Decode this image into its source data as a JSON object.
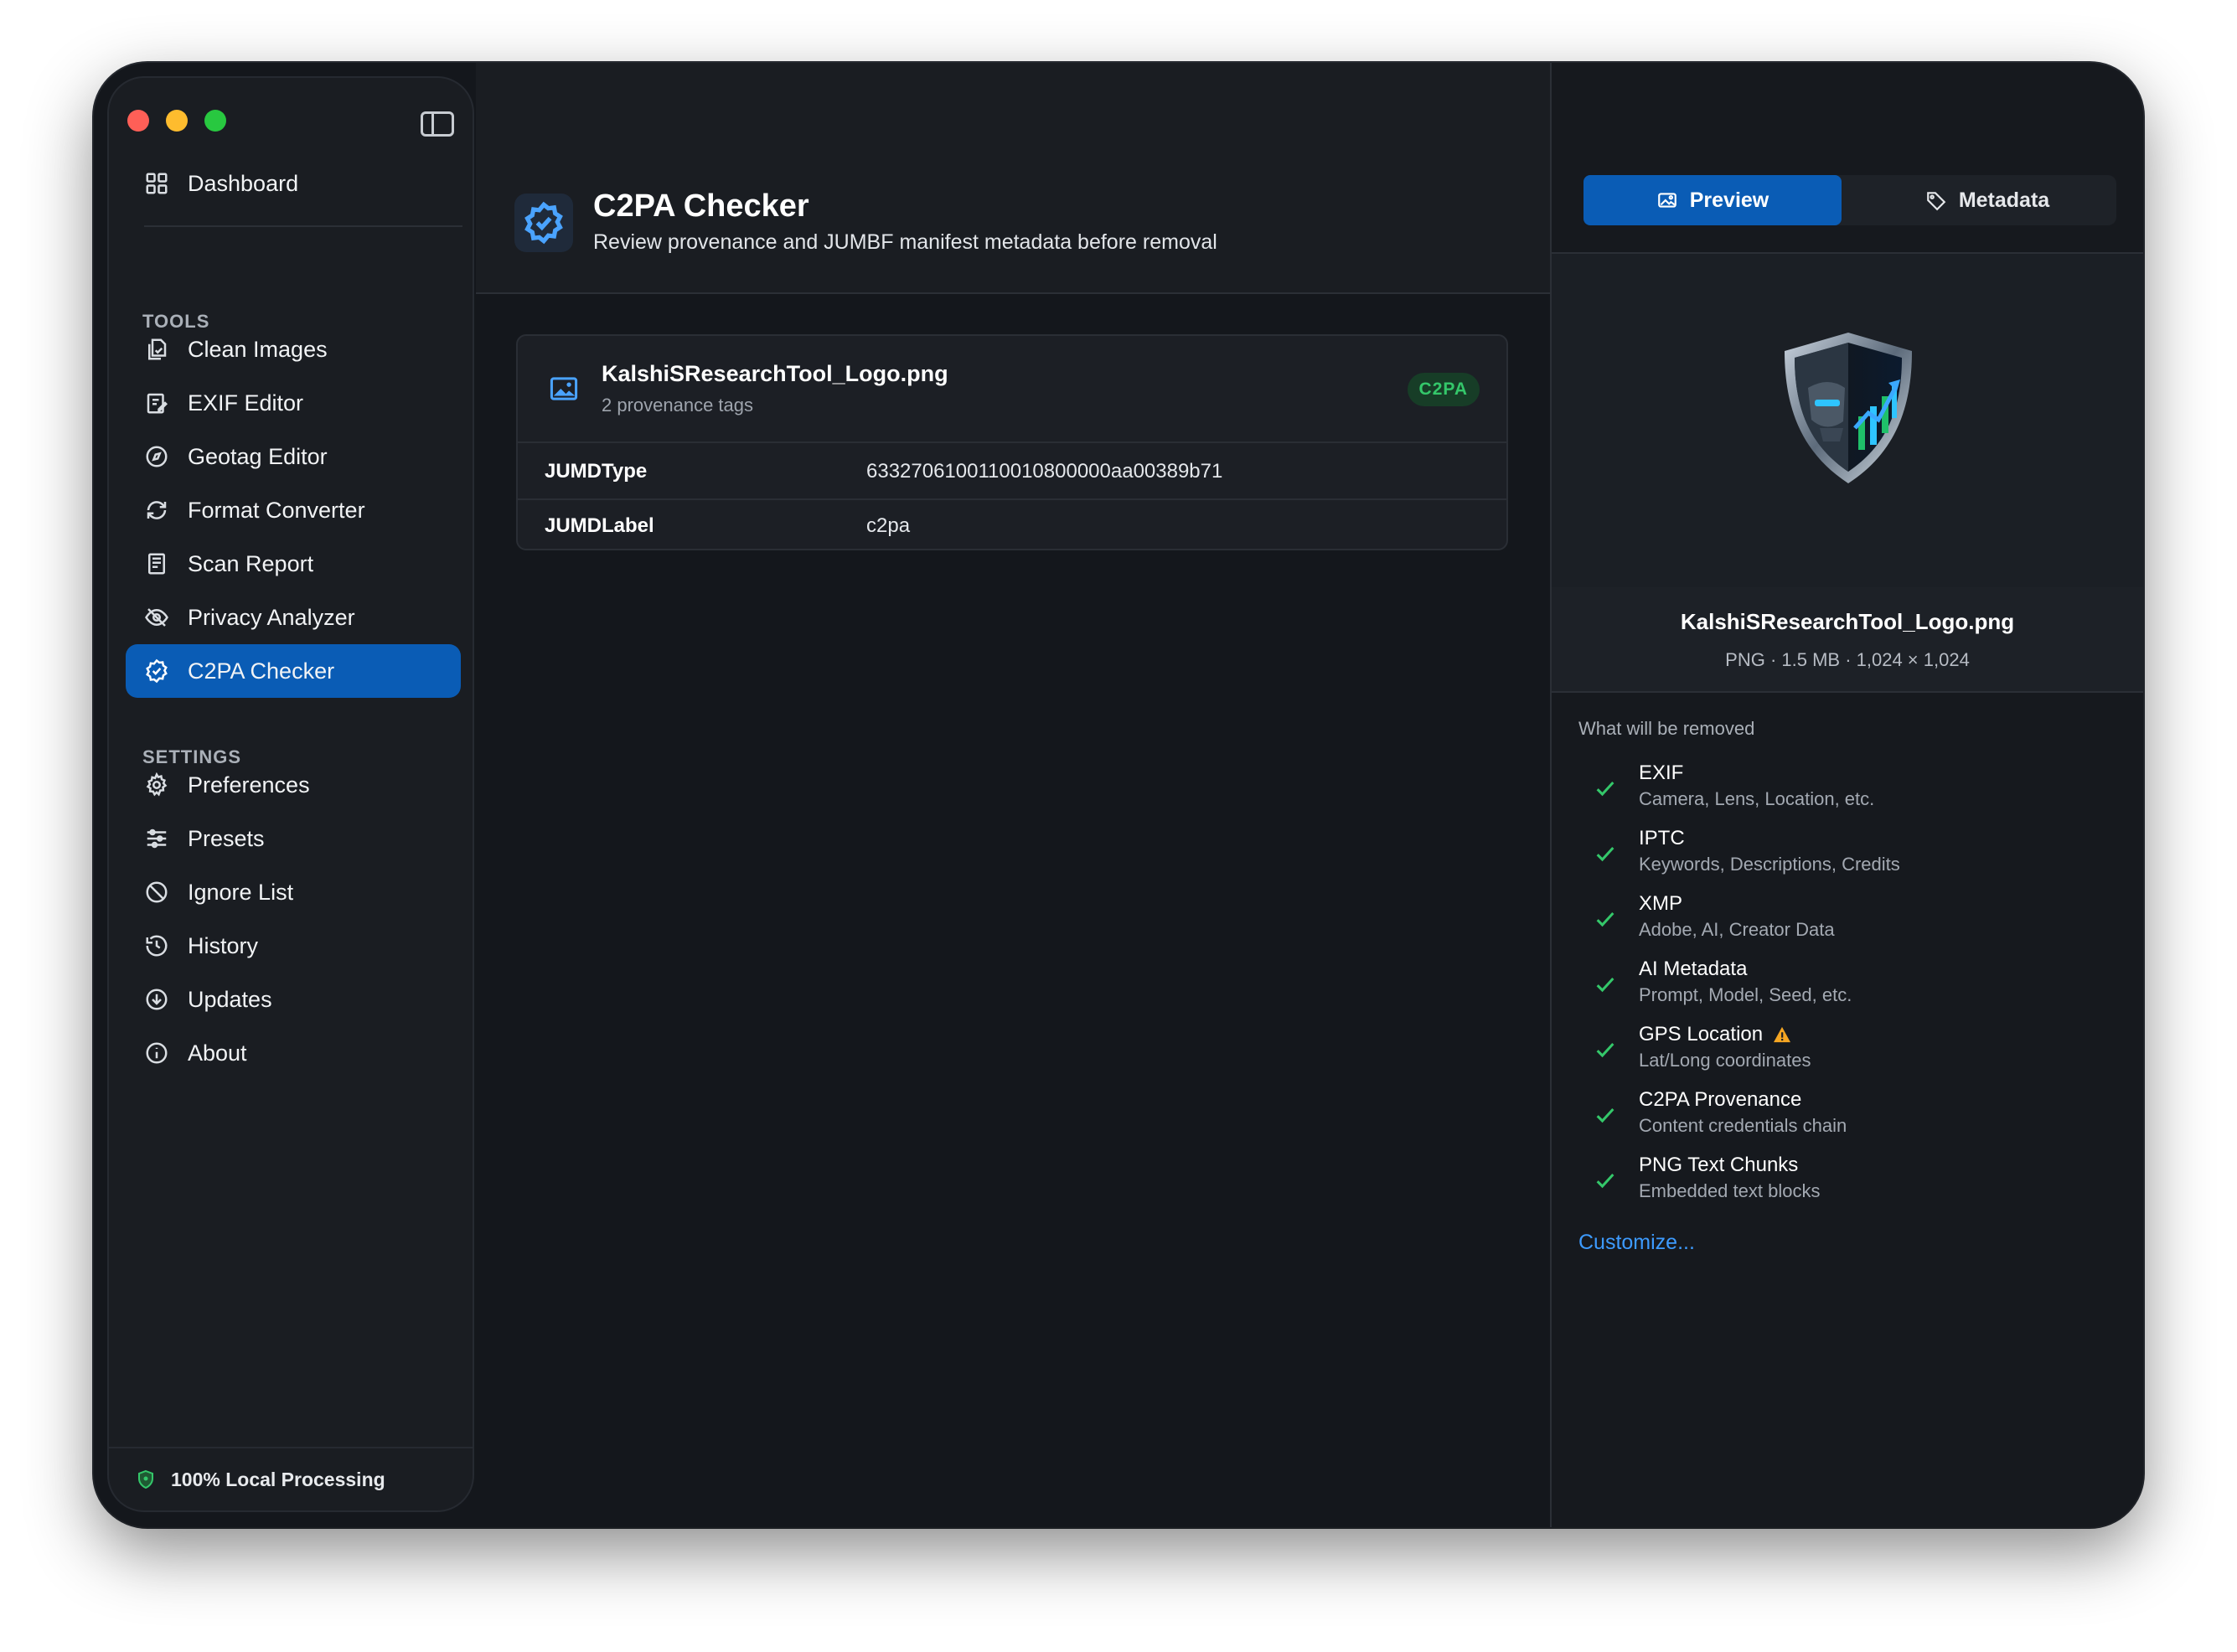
{
  "sidebar": {
    "dashboard": "Dashboard",
    "tools_label": "TOOLS",
    "tools": [
      {
        "label": "Clean Images",
        "icon": "clean-images-icon"
      },
      {
        "label": "EXIF Editor",
        "icon": "exif-editor-icon"
      },
      {
        "label": "Geotag Editor",
        "icon": "compass-icon"
      },
      {
        "label": "Format Converter",
        "icon": "convert-icon"
      },
      {
        "label": "Scan Report",
        "icon": "report-icon"
      },
      {
        "label": "Privacy Analyzer",
        "icon": "eye-slash-icon"
      },
      {
        "label": "C2PA Checker",
        "icon": "seal-check-icon",
        "active": true
      }
    ],
    "settings_label": "SETTINGS",
    "settings": [
      {
        "label": "Preferences",
        "icon": "gear-icon"
      },
      {
        "label": "Presets",
        "icon": "sliders-icon"
      },
      {
        "label": "Ignore List",
        "icon": "prohibited-icon"
      },
      {
        "label": "History",
        "icon": "history-icon"
      },
      {
        "label": "Updates",
        "icon": "download-icon"
      },
      {
        "label": "About",
        "icon": "info-icon"
      }
    ],
    "footer": "100% Local Processing"
  },
  "main": {
    "title": "C2PA Checker",
    "subtitle": "Review provenance and JUMBF manifest metadata before removal",
    "file": {
      "name": "KalshiSResearchTool_Logo.png",
      "sub": "2 provenance tags",
      "badge": "C2PA",
      "rows": [
        {
          "key": "JUMDType",
          "value": "6332706100110010800000aa00389b71"
        },
        {
          "key": "JUMDLabel",
          "value": "c2pa"
        }
      ]
    }
  },
  "inspector": {
    "tabs": {
      "preview": "Preview",
      "metadata": "Metadata"
    },
    "file_name": "KalshiSResearchTool_Logo.png",
    "meta": "PNG  ·  1.5 MB  ·  1,024 × 1,024",
    "removed_label": "What will be removed",
    "items": [
      {
        "title": "EXIF",
        "desc": "Camera, Lens, Location, etc."
      },
      {
        "title": "IPTC",
        "desc": "Keywords, Descriptions, Credits"
      },
      {
        "title": "XMP",
        "desc": "Adobe, AI, Creator Data"
      },
      {
        "title": "AI Metadata",
        "desc": "Prompt, Model, Seed, etc."
      },
      {
        "title": "GPS Location",
        "desc": "Lat/Long coordinates",
        "warning": true
      },
      {
        "title": "C2PA Provenance",
        "desc": "Content credentials chain"
      },
      {
        "title": "PNG Text Chunks",
        "desc": "Embedded text blocks"
      }
    ],
    "customize": "Customize..."
  },
  "colors": {
    "accent": "#0a5cb5",
    "success": "#34c76a",
    "warning": "#f5a623",
    "link": "#3d9bff"
  }
}
